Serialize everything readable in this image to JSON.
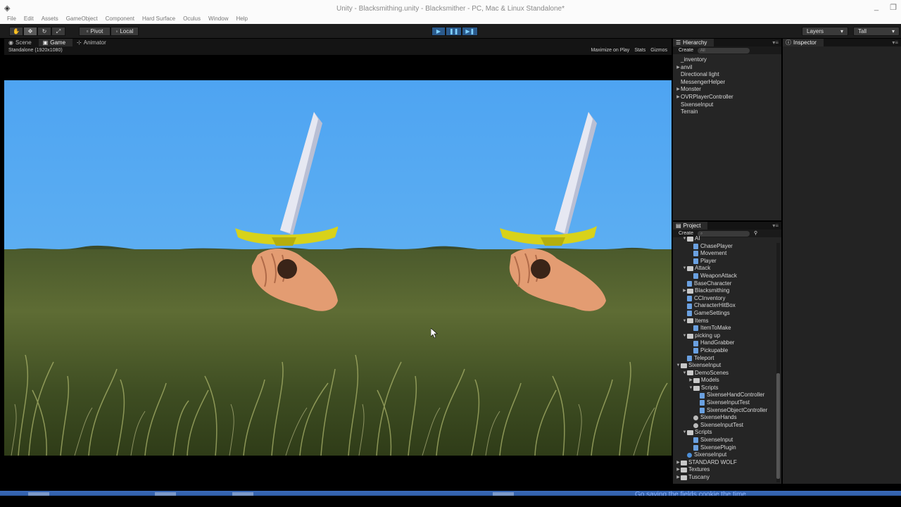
{
  "window": {
    "title": "Unity - Blacksmithing.unity - Blacksmither - PC, Mac & Linux Standalone*",
    "minimize": "_",
    "restore": "❐"
  },
  "menu": [
    "File",
    "Edit",
    "Assets",
    "GameObject",
    "Component",
    "Hard Surface",
    "Oculus",
    "Window",
    "Help"
  ],
  "toolbar": {
    "pivot": "Pivot",
    "local": "Local",
    "layers": "Layers",
    "layout": "Tall"
  },
  "view_tabs": [
    "Scene",
    "Game",
    "Animator"
  ],
  "game_view": {
    "resolution": "Standalone (1920x1080)",
    "maximize": "Maximize on Play",
    "stats": "Stats",
    "gizmos": "Gizmos"
  },
  "hierarchy": {
    "tab": "Hierarchy",
    "create": "Create",
    "search_placeholder": "All",
    "items": [
      {
        "label": "_inventory",
        "expand": false
      },
      {
        "label": "anvil",
        "expand": true
      },
      {
        "label": "Directional light",
        "expand": false
      },
      {
        "label": "MessengerHelper",
        "expand": false
      },
      {
        "label": "Monster",
        "expand": true
      },
      {
        "label": "OVRPlayerController",
        "expand": true
      },
      {
        "label": "SixenseInput",
        "expand": false
      },
      {
        "label": "Terrain",
        "expand": false
      }
    ]
  },
  "project": {
    "tab": "Project",
    "create": "Create",
    "items": [
      {
        "label": "AI",
        "type": "folder",
        "depth": 1,
        "arrow": "open"
      },
      {
        "label": "ChasePlayer",
        "type": "script",
        "depth": 2,
        "arrow": ""
      },
      {
        "label": "Movement",
        "type": "script",
        "depth": 2,
        "arrow": ""
      },
      {
        "label": "Player",
        "type": "script",
        "depth": 2,
        "arrow": ""
      },
      {
        "label": "Attack",
        "type": "folder",
        "depth": 1,
        "arrow": "open"
      },
      {
        "label": "WeaponAttack",
        "type": "script",
        "depth": 2,
        "arrow": ""
      },
      {
        "label": "BaseCharacter",
        "type": "script",
        "depth": 1,
        "arrow": ""
      },
      {
        "label": "Blacksmithing",
        "type": "folder",
        "depth": 1,
        "arrow": "closed"
      },
      {
        "label": "CCInventory",
        "type": "script",
        "depth": 1,
        "arrow": ""
      },
      {
        "label": "CharacterHitBox",
        "type": "script",
        "depth": 1,
        "arrow": ""
      },
      {
        "label": "GameSettings",
        "type": "script",
        "depth": 1,
        "arrow": ""
      },
      {
        "label": "Items",
        "type": "folder",
        "depth": 1,
        "arrow": "open"
      },
      {
        "label": "ItemToMake",
        "type": "script",
        "depth": 2,
        "arrow": ""
      },
      {
        "label": "picking up",
        "type": "folder",
        "depth": 1,
        "arrow": "open"
      },
      {
        "label": "HandGrabber",
        "type": "script",
        "depth": 2,
        "arrow": ""
      },
      {
        "label": "Pickupable",
        "type": "script",
        "depth": 2,
        "arrow": ""
      },
      {
        "label": "Teleport",
        "type": "script",
        "depth": 1,
        "arrow": ""
      },
      {
        "label": "SixenseInput",
        "type": "folder",
        "depth": 0,
        "arrow": "open"
      },
      {
        "label": "DemoScenes",
        "type": "folder",
        "depth": 1,
        "arrow": "open"
      },
      {
        "label": "Models",
        "type": "folder",
        "depth": 2,
        "arrow": "closed"
      },
      {
        "label": "Scripts",
        "type": "folder",
        "depth": 2,
        "arrow": "open"
      },
      {
        "label": "SixenseHandController",
        "type": "script",
        "depth": 3,
        "arrow": ""
      },
      {
        "label": "SixenseInputTest",
        "type": "script",
        "depth": 3,
        "arrow": ""
      },
      {
        "label": "SixenseObjectController",
        "type": "script",
        "depth": 3,
        "arrow": ""
      },
      {
        "label": "SixenseHands",
        "type": "prefab",
        "depth": 2,
        "arrow": ""
      },
      {
        "label": "SixenseInputTest",
        "type": "prefab",
        "depth": 2,
        "arrow": ""
      },
      {
        "label": "Scripts",
        "type": "folder",
        "depth": 1,
        "arrow": "open"
      },
      {
        "label": "SixenseInput",
        "type": "script",
        "depth": 2,
        "arrow": ""
      },
      {
        "label": "SixensePlugin",
        "type": "script",
        "depth": 2,
        "arrow": ""
      },
      {
        "label": "SixenseInput",
        "type": "sphere",
        "depth": 1,
        "arrow": ""
      },
      {
        "label": "STANDARD WOLF",
        "type": "folder",
        "depth": 0,
        "arrow": "closed"
      },
      {
        "label": "Textures",
        "type": "folder",
        "depth": 0,
        "arrow": "closed"
      },
      {
        "label": "Tuscany",
        "type": "folder",
        "depth": 0,
        "arrow": "closed"
      }
    ]
  },
  "inspector": {
    "tab": "Inspector"
  },
  "taskbar": {
    "caption": "Go saving the fields cookie the time"
  }
}
